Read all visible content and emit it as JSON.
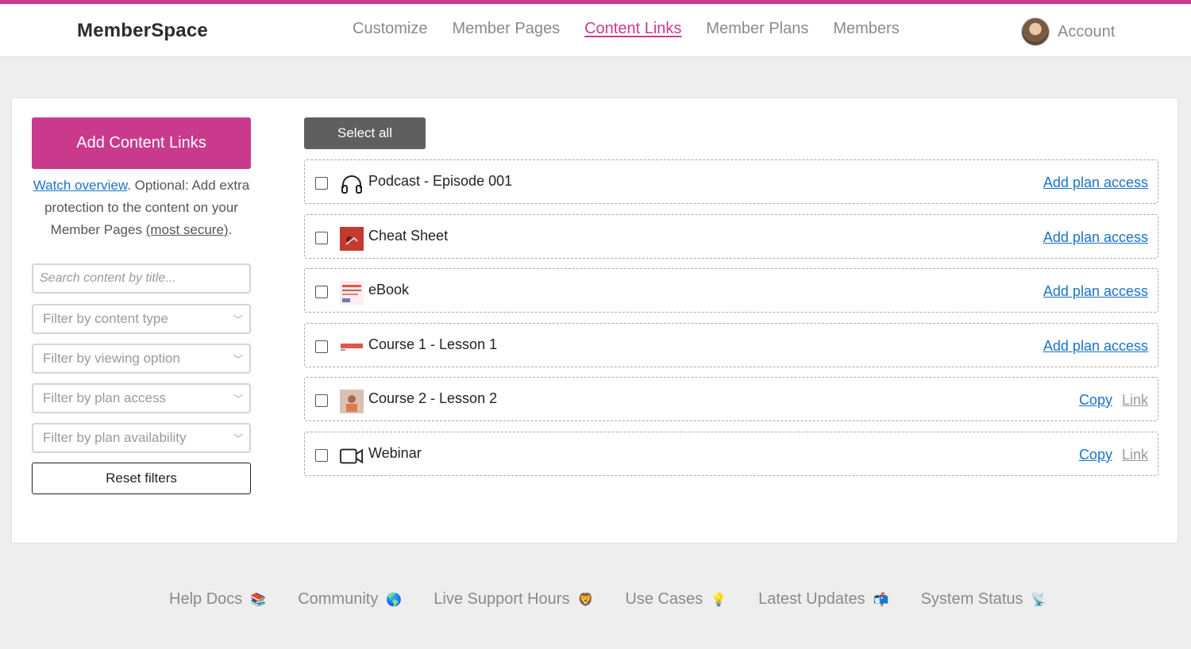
{
  "header": {
    "logo": "MemberSpace",
    "nav": [
      "Customize",
      "Member Pages",
      "Content Links",
      "Member Plans",
      "Members"
    ],
    "active_nav": "Content Links",
    "account_label": "Account"
  },
  "sidebar": {
    "add_button_label": "Add Content Links",
    "watch_link": "Watch overview",
    "description": ". Optional: Add extra protection to the content on your Member Pages ",
    "secure_link": "(most secure)",
    "description_end": ".",
    "search_placeholder": "Search content by title...",
    "filters": [
      "Filter by content type",
      "Filter by viewing option",
      "Filter by plan access",
      "Filter by plan availability"
    ],
    "reset_label": "Reset filters"
  },
  "content": {
    "select_all_label": "Select all",
    "items": [
      {
        "title": "Podcast - Episode 001",
        "icon": "headphones-icon",
        "action": "Add plan access"
      },
      {
        "title": "Cheat Sheet",
        "icon": "thumbnail-red",
        "action": "Add plan access"
      },
      {
        "title": "eBook",
        "icon": "thumbnail-document",
        "action": "Add plan access"
      },
      {
        "title": "Course 1 - Lesson 1",
        "icon": "thumbnail-banner",
        "action": "Add plan access"
      },
      {
        "title": "Course 2 - Lesson 2",
        "icon": "thumbnail-photo",
        "copy": "Copy",
        "link": "Link"
      },
      {
        "title": "Webinar",
        "icon": "video-camera-icon",
        "copy": "Copy",
        "link": "Link"
      }
    ]
  },
  "footer": {
    "links": [
      {
        "label": "Help Docs",
        "emoji": "📚"
      },
      {
        "label": "Community",
        "emoji": "🌎"
      },
      {
        "label": "Live Support Hours",
        "emoji": "🦁"
      },
      {
        "label": "Use Cases",
        "emoji": "💡"
      },
      {
        "label": "Latest Updates",
        "emoji": "📬"
      },
      {
        "label": "System Status",
        "emoji": "📡"
      }
    ]
  },
  "colors": {
    "accent": "#c93a8c",
    "link": "#1a73c9",
    "dark_button": "#5f5f5f"
  }
}
